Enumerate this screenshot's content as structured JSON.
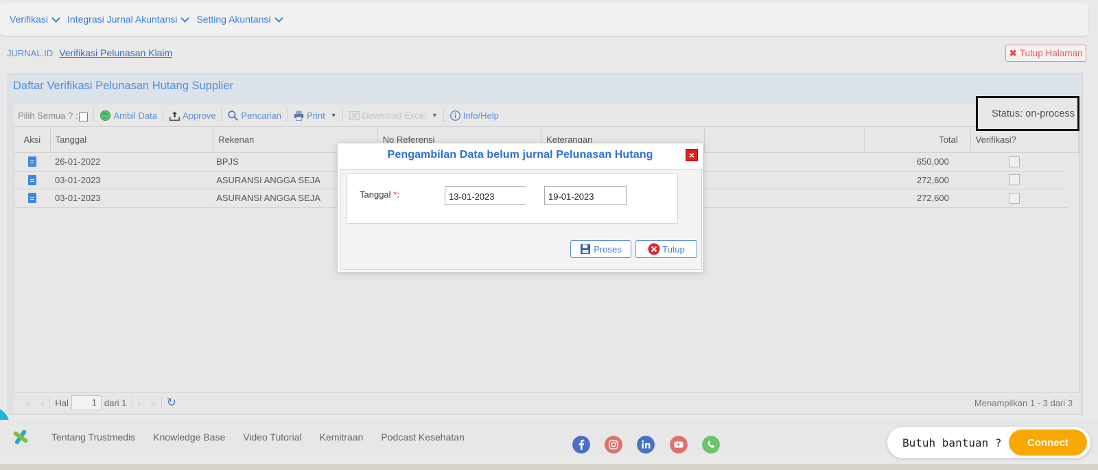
{
  "nav": {
    "menus": [
      {
        "label": "Verifikasi"
      },
      {
        "label": "Integrasi Jurnal Akuntansi"
      },
      {
        "label": "Setting Akuntansi"
      }
    ]
  },
  "breadcrumb": {
    "root": "JURNAL.ID",
    "page": "Verifikasi Pelunasan Klaim"
  },
  "close_page_label": "Tutup Halaman",
  "panel": {
    "title": "Daftar Verifikasi Pelunasan Hutang Supplier",
    "toolbar": {
      "select_all": "Pilih Semua ? :",
      "ambil_data": "Ambil Data",
      "approve": "Approve",
      "pencarian": "Pencarian",
      "print": "Print",
      "download_excel": "Download Excel",
      "info_help": "Info/Help",
      "status": "Status: on-process"
    },
    "columns": {
      "aksi": "Aksi",
      "tanggal": "Tanggal",
      "rekenan": "Rekenan",
      "no_referensi": "No Referensi",
      "keterangan": "Keterangan",
      "total": "Total",
      "verifikasi": "Verifikasi?"
    },
    "rows": [
      {
        "tanggal": "26-01-2022",
        "rekenan": "BPJS",
        "total": "650,000"
      },
      {
        "tanggal": "03-01-2023",
        "rekenan": "ASURANSI ANGGA SEJA",
        "total": "272,600"
      },
      {
        "tanggal": "03-01-2023",
        "rekenan": "ASURANSI ANGGA SEJA",
        "total": "272,600"
      }
    ],
    "pager": {
      "hal": "Hal",
      "page": "1",
      "dari": "dari 1",
      "info": "Menampilkan 1 - 3 dari 3"
    }
  },
  "modal": {
    "title": "Pengambilan Data belum jurnal Pelunasan Hutang",
    "label": "Tanggal",
    "required": "*",
    "colon": ":",
    "date_from": "13-01-2023",
    "date_to": "19-01-2023",
    "proses": "Proses",
    "tutup": "Tutup"
  },
  "footer": {
    "links": [
      "Tentang Trustmedis",
      "Knowledge Base",
      "Video Tutorial",
      "Kemitraan",
      "Podcast Kesehatan"
    ],
    "social_icons": [
      "facebook-icon",
      "instagram-icon",
      "linkedin-icon",
      "youtube-icon",
      "whatsapp-icon"
    ]
  },
  "help": {
    "text": "Butuh bantuan ?",
    "connect": "Connect"
  },
  "colors": {
    "accent": "#3b7fd6",
    "close_red": "#e02020",
    "connect_orange": "#f8a800"
  }
}
